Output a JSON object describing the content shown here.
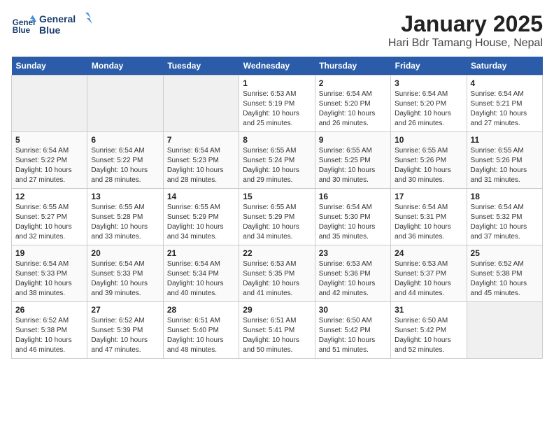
{
  "header": {
    "logo_line1": "General",
    "logo_line2": "Blue",
    "title": "January 2025",
    "subtitle": "Hari Bdr Tamang House, Nepal"
  },
  "weekdays": [
    "Sunday",
    "Monday",
    "Tuesday",
    "Wednesday",
    "Thursday",
    "Friday",
    "Saturday"
  ],
  "weeks": [
    [
      {
        "day": "",
        "sunrise": "",
        "sunset": "",
        "daylight": ""
      },
      {
        "day": "",
        "sunrise": "",
        "sunset": "",
        "daylight": ""
      },
      {
        "day": "",
        "sunrise": "",
        "sunset": "",
        "daylight": ""
      },
      {
        "day": "1",
        "sunrise": "Sunrise: 6:53 AM",
        "sunset": "Sunset: 5:19 PM",
        "daylight": "Daylight: 10 hours and 25 minutes."
      },
      {
        "day": "2",
        "sunrise": "Sunrise: 6:54 AM",
        "sunset": "Sunset: 5:20 PM",
        "daylight": "Daylight: 10 hours and 26 minutes."
      },
      {
        "day": "3",
        "sunrise": "Sunrise: 6:54 AM",
        "sunset": "Sunset: 5:20 PM",
        "daylight": "Daylight: 10 hours and 26 minutes."
      },
      {
        "day": "4",
        "sunrise": "Sunrise: 6:54 AM",
        "sunset": "Sunset: 5:21 PM",
        "daylight": "Daylight: 10 hours and 27 minutes."
      }
    ],
    [
      {
        "day": "5",
        "sunrise": "Sunrise: 6:54 AM",
        "sunset": "Sunset: 5:22 PM",
        "daylight": "Daylight: 10 hours and 27 minutes."
      },
      {
        "day": "6",
        "sunrise": "Sunrise: 6:54 AM",
        "sunset": "Sunset: 5:22 PM",
        "daylight": "Daylight: 10 hours and 28 minutes."
      },
      {
        "day": "7",
        "sunrise": "Sunrise: 6:54 AM",
        "sunset": "Sunset: 5:23 PM",
        "daylight": "Daylight: 10 hours and 28 minutes."
      },
      {
        "day": "8",
        "sunrise": "Sunrise: 6:55 AM",
        "sunset": "Sunset: 5:24 PM",
        "daylight": "Daylight: 10 hours and 29 minutes."
      },
      {
        "day": "9",
        "sunrise": "Sunrise: 6:55 AM",
        "sunset": "Sunset: 5:25 PM",
        "daylight": "Daylight: 10 hours and 30 minutes."
      },
      {
        "day": "10",
        "sunrise": "Sunrise: 6:55 AM",
        "sunset": "Sunset: 5:26 PM",
        "daylight": "Daylight: 10 hours and 30 minutes."
      },
      {
        "day": "11",
        "sunrise": "Sunrise: 6:55 AM",
        "sunset": "Sunset: 5:26 PM",
        "daylight": "Daylight: 10 hours and 31 minutes."
      }
    ],
    [
      {
        "day": "12",
        "sunrise": "Sunrise: 6:55 AM",
        "sunset": "Sunset: 5:27 PM",
        "daylight": "Daylight: 10 hours and 32 minutes."
      },
      {
        "day": "13",
        "sunrise": "Sunrise: 6:55 AM",
        "sunset": "Sunset: 5:28 PM",
        "daylight": "Daylight: 10 hours and 33 minutes."
      },
      {
        "day": "14",
        "sunrise": "Sunrise: 6:55 AM",
        "sunset": "Sunset: 5:29 PM",
        "daylight": "Daylight: 10 hours and 34 minutes."
      },
      {
        "day": "15",
        "sunrise": "Sunrise: 6:55 AM",
        "sunset": "Sunset: 5:29 PM",
        "daylight": "Daylight: 10 hours and 34 minutes."
      },
      {
        "day": "16",
        "sunrise": "Sunrise: 6:54 AM",
        "sunset": "Sunset: 5:30 PM",
        "daylight": "Daylight: 10 hours and 35 minutes."
      },
      {
        "day": "17",
        "sunrise": "Sunrise: 6:54 AM",
        "sunset": "Sunset: 5:31 PM",
        "daylight": "Daylight: 10 hours and 36 minutes."
      },
      {
        "day": "18",
        "sunrise": "Sunrise: 6:54 AM",
        "sunset": "Sunset: 5:32 PM",
        "daylight": "Daylight: 10 hours and 37 minutes."
      }
    ],
    [
      {
        "day": "19",
        "sunrise": "Sunrise: 6:54 AM",
        "sunset": "Sunset: 5:33 PM",
        "daylight": "Daylight: 10 hours and 38 minutes."
      },
      {
        "day": "20",
        "sunrise": "Sunrise: 6:54 AM",
        "sunset": "Sunset: 5:33 PM",
        "daylight": "Daylight: 10 hours and 39 minutes."
      },
      {
        "day": "21",
        "sunrise": "Sunrise: 6:54 AM",
        "sunset": "Sunset: 5:34 PM",
        "daylight": "Daylight: 10 hours and 40 minutes."
      },
      {
        "day": "22",
        "sunrise": "Sunrise: 6:53 AM",
        "sunset": "Sunset: 5:35 PM",
        "daylight": "Daylight: 10 hours and 41 minutes."
      },
      {
        "day": "23",
        "sunrise": "Sunrise: 6:53 AM",
        "sunset": "Sunset: 5:36 PM",
        "daylight": "Daylight: 10 hours and 42 minutes."
      },
      {
        "day": "24",
        "sunrise": "Sunrise: 6:53 AM",
        "sunset": "Sunset: 5:37 PM",
        "daylight": "Daylight: 10 hours and 44 minutes."
      },
      {
        "day": "25",
        "sunrise": "Sunrise: 6:52 AM",
        "sunset": "Sunset: 5:38 PM",
        "daylight": "Daylight: 10 hours and 45 minutes."
      }
    ],
    [
      {
        "day": "26",
        "sunrise": "Sunrise: 6:52 AM",
        "sunset": "Sunset: 5:38 PM",
        "daylight": "Daylight: 10 hours and 46 minutes."
      },
      {
        "day": "27",
        "sunrise": "Sunrise: 6:52 AM",
        "sunset": "Sunset: 5:39 PM",
        "daylight": "Daylight: 10 hours and 47 minutes."
      },
      {
        "day": "28",
        "sunrise": "Sunrise: 6:51 AM",
        "sunset": "Sunset: 5:40 PM",
        "daylight": "Daylight: 10 hours and 48 minutes."
      },
      {
        "day": "29",
        "sunrise": "Sunrise: 6:51 AM",
        "sunset": "Sunset: 5:41 PM",
        "daylight": "Daylight: 10 hours and 50 minutes."
      },
      {
        "day": "30",
        "sunrise": "Sunrise: 6:50 AM",
        "sunset": "Sunset: 5:42 PM",
        "daylight": "Daylight: 10 hours and 51 minutes."
      },
      {
        "day": "31",
        "sunrise": "Sunrise: 6:50 AM",
        "sunset": "Sunset: 5:42 PM",
        "daylight": "Daylight: 10 hours and 52 minutes."
      },
      {
        "day": "",
        "sunrise": "",
        "sunset": "",
        "daylight": ""
      }
    ]
  ]
}
